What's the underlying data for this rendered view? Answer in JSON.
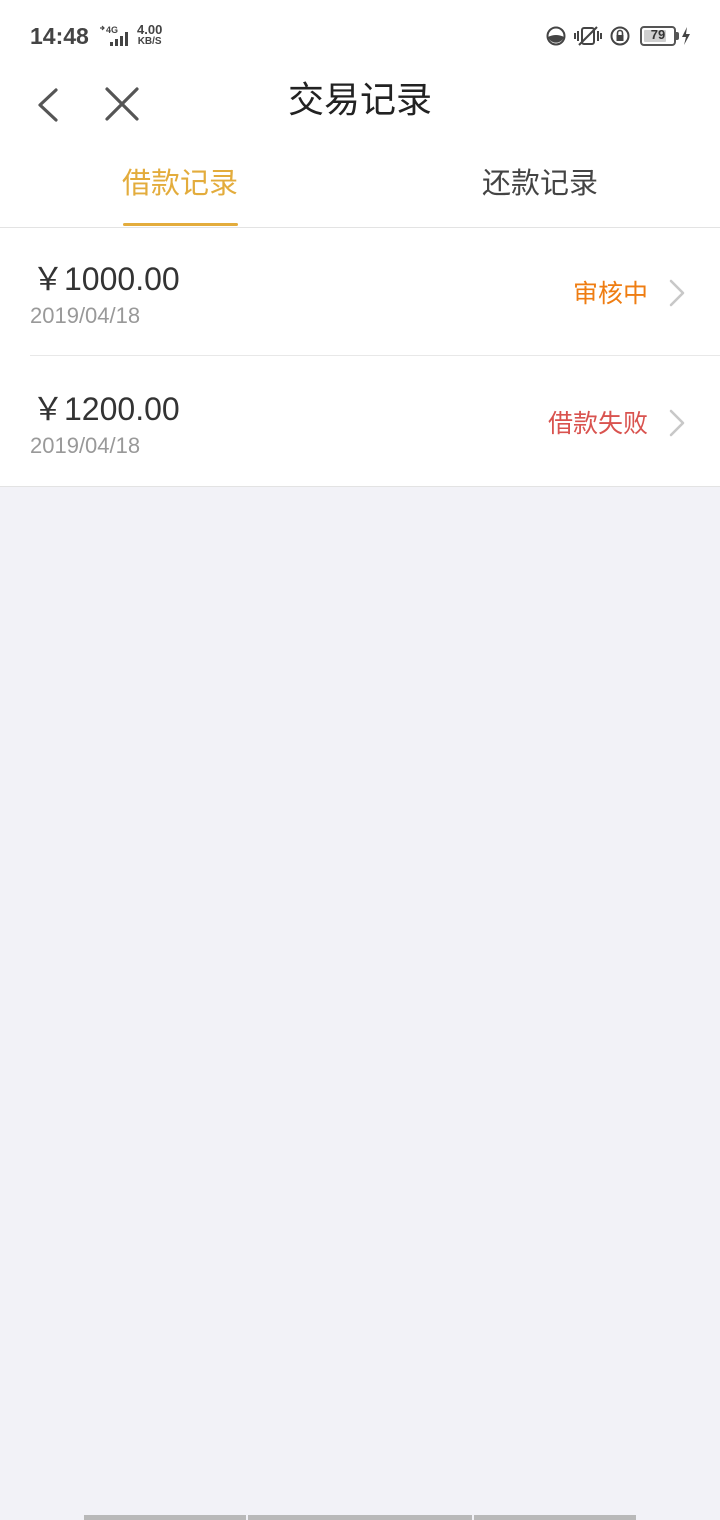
{
  "status_bar": {
    "time": "14:48",
    "network": "4G",
    "speed_value": "4.00",
    "speed_unit": "KB/S",
    "battery_level": "79",
    "icons": [
      "data-saver-icon",
      "vibrate-icon",
      "rotation-lock-icon",
      "battery-icon",
      "charging-icon"
    ]
  },
  "nav": {
    "title": "交易记录",
    "back_icon": "chevron-left-icon",
    "close_icon": "close-icon"
  },
  "tabs": [
    {
      "label": "借款记录",
      "active": true
    },
    {
      "label": "还款记录",
      "active": false
    }
  ],
  "records": [
    {
      "amount": "￥1000.00",
      "date": "2019/04/18",
      "status": "审核中",
      "status_color": "#ef7d12"
    },
    {
      "amount": "￥1200.00",
      "date": "2019/04/18",
      "status": "借款失败",
      "status_color": "#d9534f"
    }
  ],
  "colors": {
    "accent": "#e3ac3c",
    "background": "#f2f2f7"
  }
}
